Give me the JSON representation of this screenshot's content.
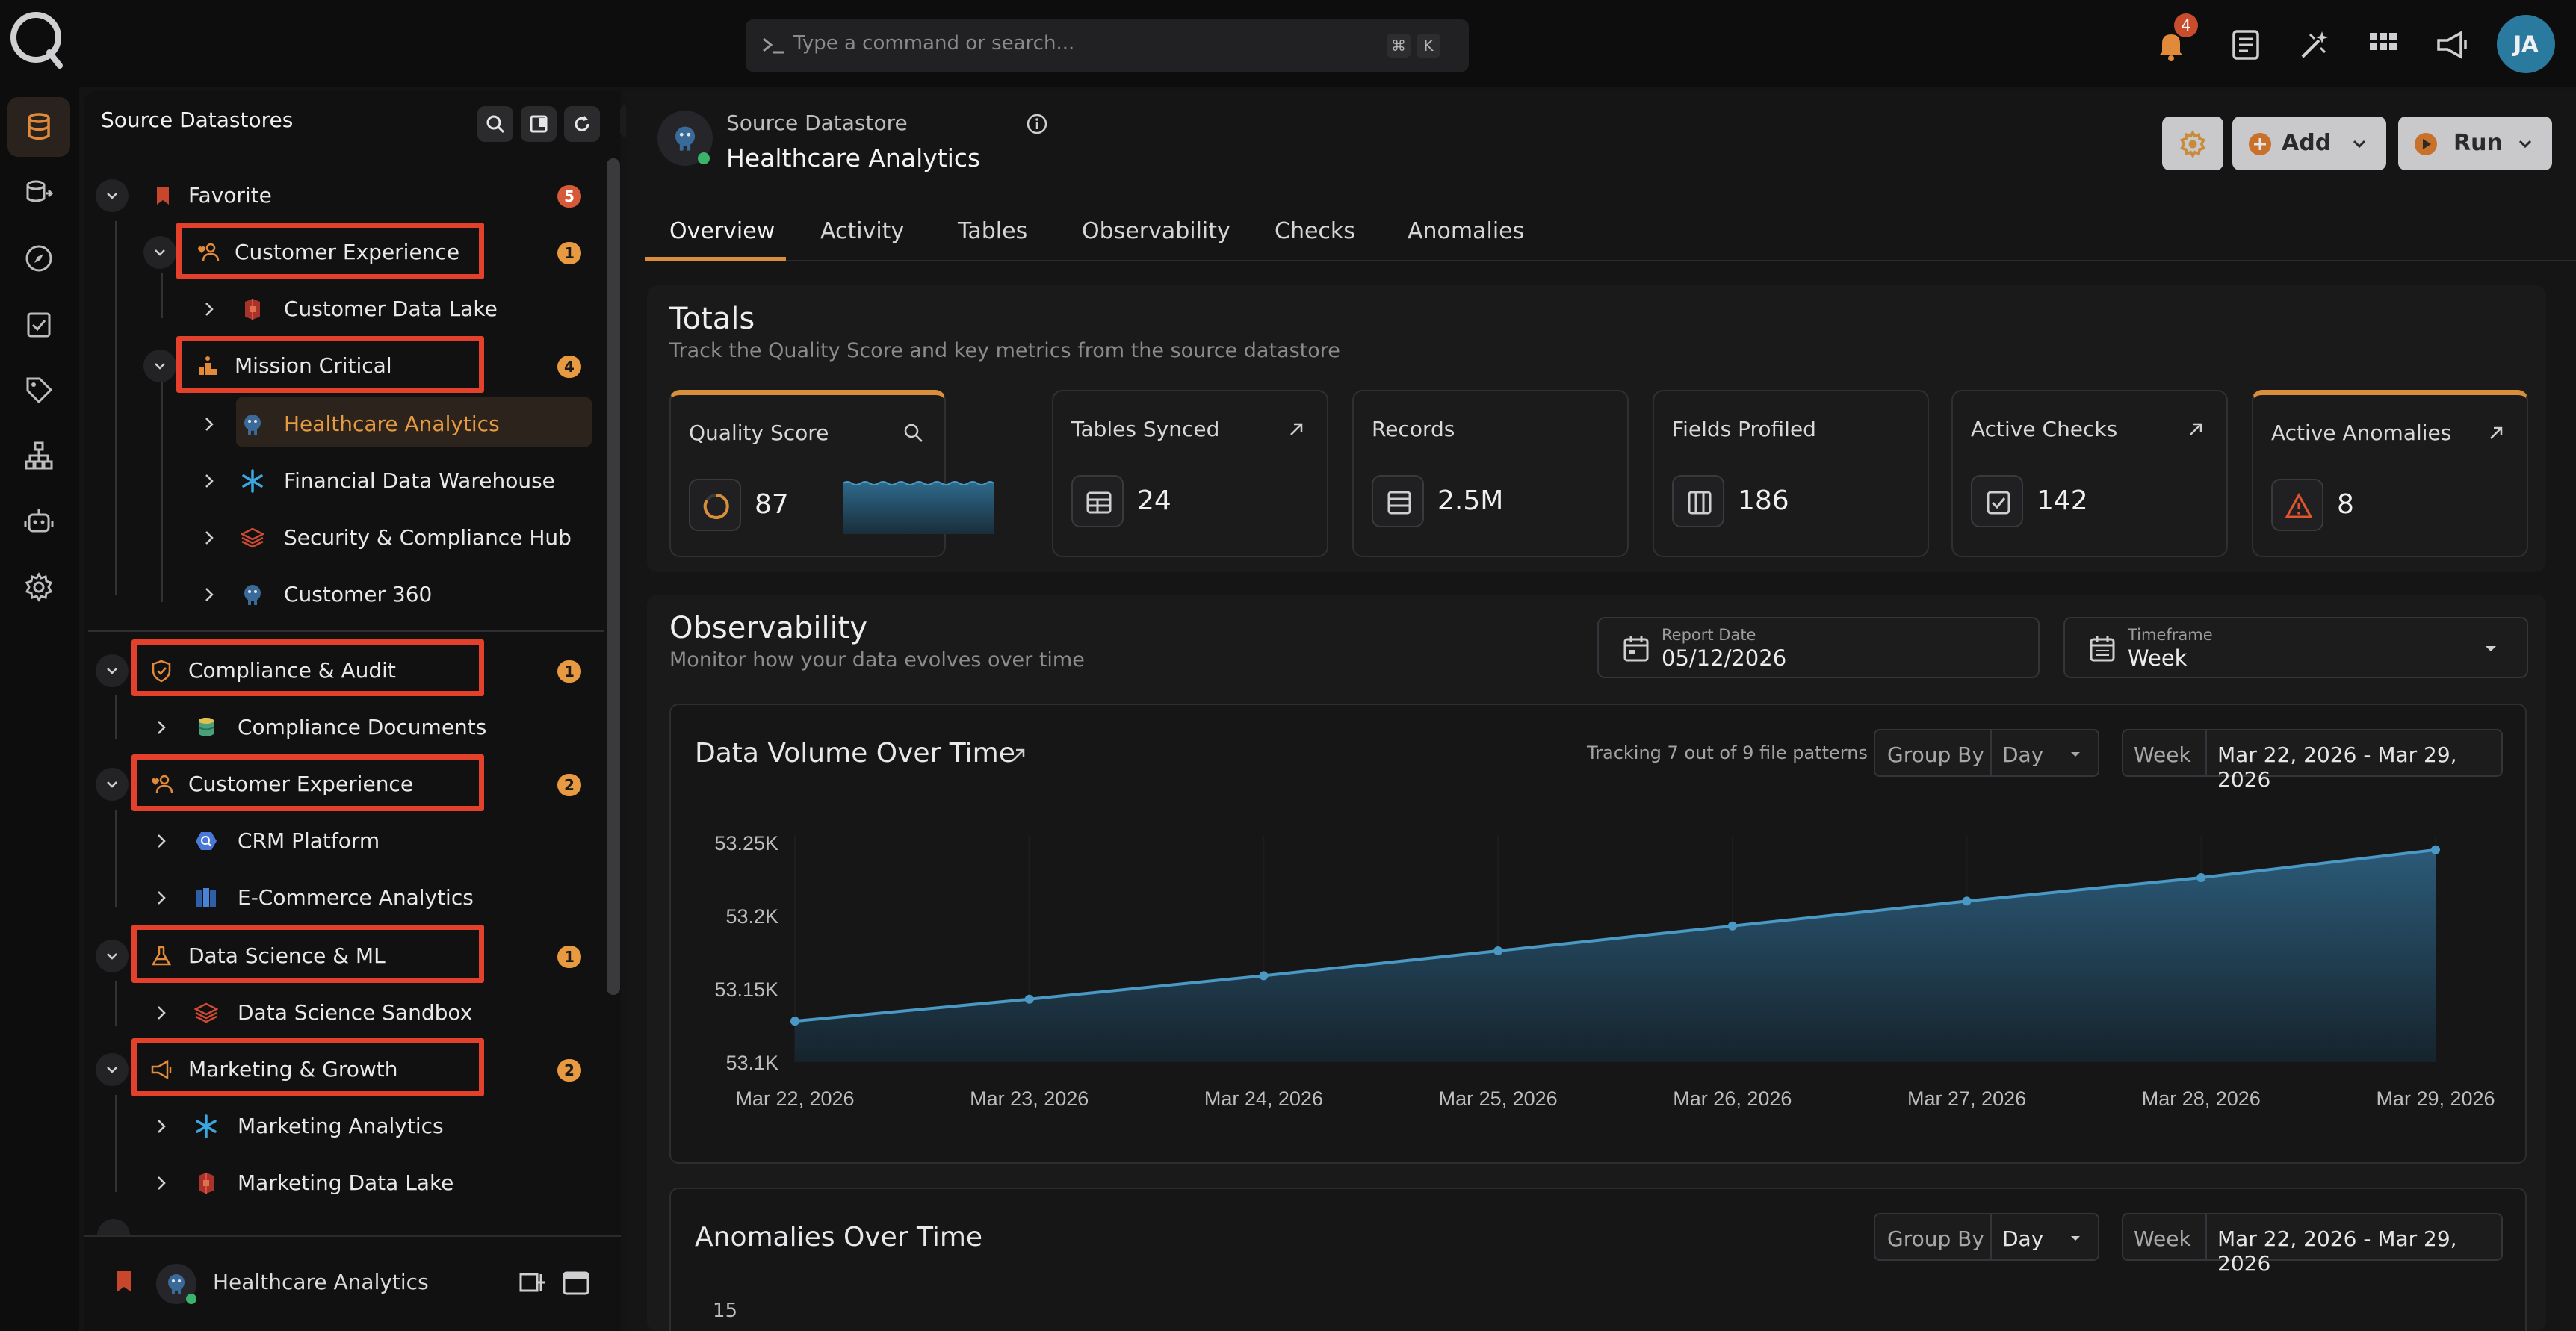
{
  "topbar": {
    "command_placeholder": "Type a command or search...",
    "kbd_mod": "⌘",
    "kbd_key": "K",
    "notification_count": "4",
    "avatar_initials": "JA"
  },
  "sidebar": {
    "title": "Source Datastores",
    "footer_label": "Healthcare Analytics",
    "items": [
      {
        "label": "Favorite",
        "count": "5"
      },
      {
        "label": "Customer Experience",
        "count": "1"
      },
      {
        "label": "Customer Data Lake"
      },
      {
        "label": "Mission Critical",
        "count": "4"
      },
      {
        "label": "Healthcare Analytics"
      },
      {
        "label": "Financial Data Warehouse"
      },
      {
        "label": "Security & Compliance Hub"
      },
      {
        "label": "Customer 360"
      },
      {
        "label": "Compliance & Audit",
        "count": "1"
      },
      {
        "label": "Compliance Documents"
      },
      {
        "label": "Customer Experience",
        "count": "2"
      },
      {
        "label": "CRM Platform"
      },
      {
        "label": "E-Commerce Analytics"
      },
      {
        "label": "Data Science & ML",
        "count": "1"
      },
      {
        "label": "Data Science Sandbox"
      },
      {
        "label": "Marketing & Growth",
        "count": "2"
      },
      {
        "label": "Marketing Analytics"
      },
      {
        "label": "Marketing Data Lake"
      }
    ]
  },
  "header": {
    "subtitle": "Source Datastore",
    "title": "Healthcare Analytics",
    "add_label": "Add",
    "run_label": "Run"
  },
  "tabs": [
    "Overview",
    "Activity",
    "Tables",
    "Observability",
    "Checks",
    "Anomalies"
  ],
  "totals": {
    "title": "Totals",
    "description": "Track the Quality Score and key metrics from the source datastore",
    "cards": [
      {
        "label": "Quality Score",
        "value": "87"
      },
      {
        "label": "Tables Synced",
        "value": "24"
      },
      {
        "label": "Records",
        "value": "2.5M"
      },
      {
        "label": "Fields Profiled",
        "value": "186"
      },
      {
        "label": "Active Checks",
        "value": "142"
      },
      {
        "label": "Active Anomalies",
        "value": "8"
      }
    ]
  },
  "observability": {
    "title": "Observability",
    "description": "Monitor how your data evolves over time",
    "report_date_label": "Report Date",
    "report_date_value": "05/12/2026",
    "timeframe_label": "Timeframe",
    "timeframe_value": "Week",
    "volume_chart": {
      "title": "Data Volume Over Time",
      "tracking_note": "Tracking 7 out of 9 file patterns",
      "group_by_label": "Group By",
      "group_by_value": "Day",
      "range_label": "Week",
      "range_value": "Mar 22, 2026 - Mar 29, 2026"
    },
    "anomalies_chart": {
      "title": "Anomalies Over Time",
      "group_by_label": "Group By",
      "group_by_value": "Day",
      "range_label": "Week",
      "range_value": "Mar 22, 2026 - Mar 29, 2026",
      "y_top_tick": "15"
    }
  },
  "chart_data": {
    "type": "area",
    "title": "Data Volume Over Time",
    "x": [
      "Mar 22, 2026",
      "Mar 23, 2026",
      "Mar 24, 2026",
      "Mar 25, 2026",
      "Mar 26, 2026",
      "Mar 27, 2026",
      "Mar 28, 2026",
      "Mar 29, 2026"
    ],
    "values": [
      53128,
      53143,
      53159,
      53176,
      53193,
      53210,
      53226,
      53245
    ],
    "y_ticks": [
      "53.1K",
      "53.15K",
      "53.2K",
      "53.25K"
    ],
    "y_tick_values": [
      53100,
      53150,
      53200,
      53250
    ],
    "ylim": [
      53100,
      53250
    ],
    "grid": false,
    "colors": {
      "line": "#4a98c4",
      "fill_top": "#2b5a78",
      "fill_bottom": "#16232c"
    }
  }
}
